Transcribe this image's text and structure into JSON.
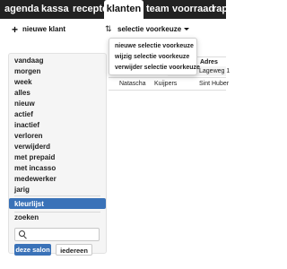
{
  "nav": {
    "tabs": [
      {
        "label": "agenda"
      },
      {
        "label": "kassa"
      },
      {
        "label": "recepten"
      },
      {
        "label": "klanten"
      },
      {
        "label": "team"
      },
      {
        "label": "voorraad"
      },
      {
        "label": "rapp"
      }
    ],
    "active": "klanten"
  },
  "toolbar": {
    "new_client_label": "nieuwe klant",
    "selection_preferences_label": "selectie voorkeuze"
  },
  "dropdown": {
    "items": [
      {
        "label": "nieuwe selectie voorkeuze"
      },
      {
        "label": "wijzig selectie voorkeuze"
      },
      {
        "label": "verwijder selectie voorkeuze"
      }
    ]
  },
  "table": {
    "headers": [
      "Adres"
    ],
    "rows": [
      {
        "address": "Lageweg 1"
      },
      {
        "first_name": "Natascha",
        "last_name": "Kuijpers",
        "address": "Sint Huber"
      }
    ]
  },
  "sidebar": {
    "items": [
      {
        "label": "vandaag"
      },
      {
        "label": "morgen"
      },
      {
        "label": "week"
      },
      {
        "label": "alles"
      },
      {
        "label": "nieuw"
      },
      {
        "label": "actief"
      },
      {
        "label": "inactief"
      },
      {
        "label": "verloren"
      },
      {
        "label": "verwijderd"
      },
      {
        "label": "met prepaid"
      },
      {
        "label": "met incasso"
      },
      {
        "label": "medewerker"
      },
      {
        "label": "jarig"
      }
    ],
    "active_label": "kleurlijst",
    "search_heading": "zoeken",
    "search_value": "",
    "this_salon_button": "deze salon",
    "everyone_button": "iedereen"
  },
  "colors": {
    "nav_bg": "#222222",
    "accent": "#3a72b8"
  }
}
